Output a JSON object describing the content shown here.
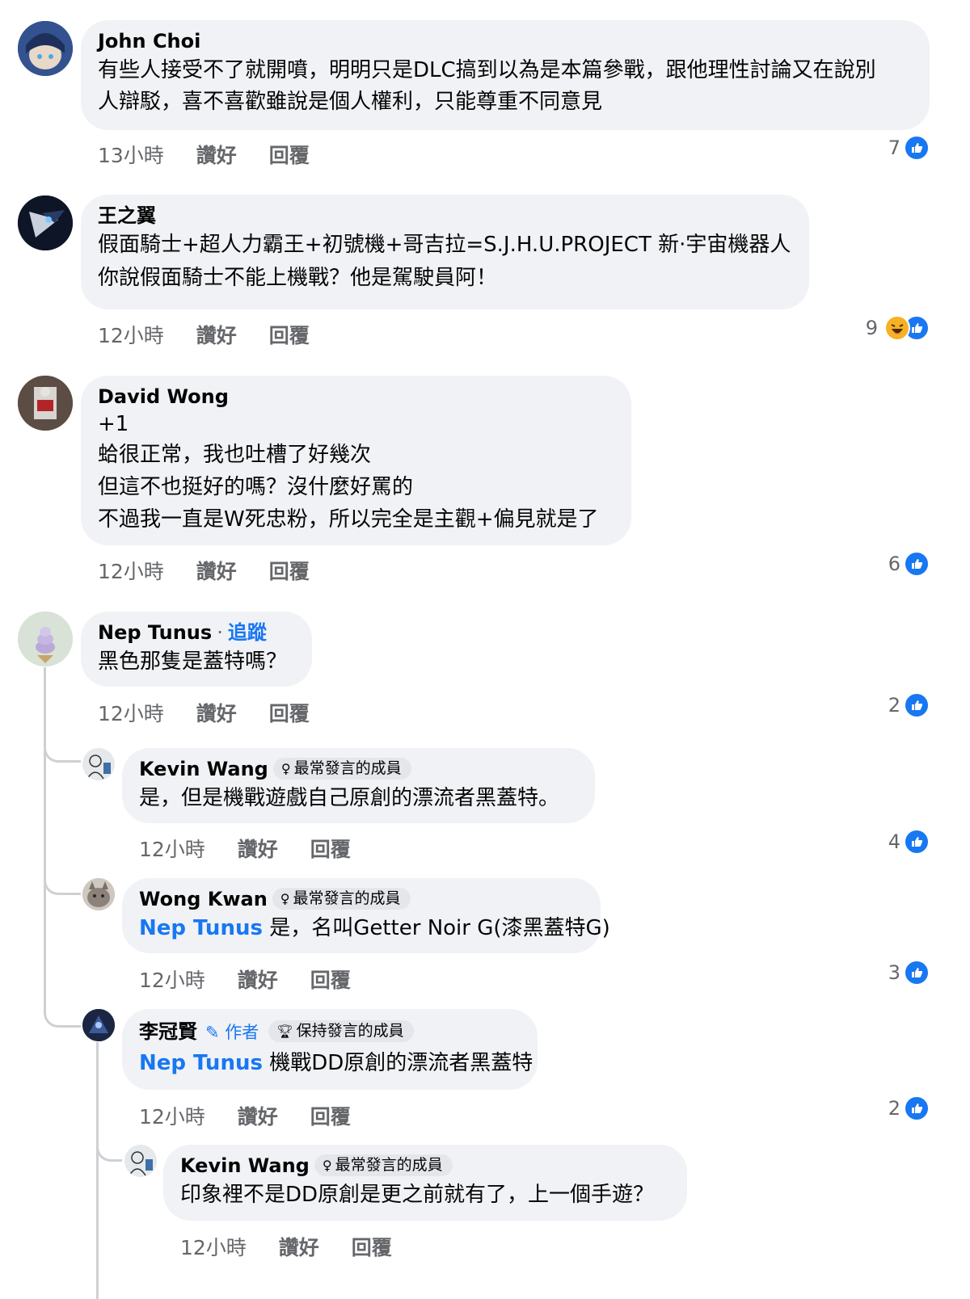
{
  "comments": [
    {
      "author": "John Choi",
      "lines": [
        "有些人接受不了就開噴，明明只是DLC搞到以為是本篇參戰，跟他理性討論又在說別",
        "人辯駁，喜不喜歡雖說是個人權利，只能尊重不同意見"
      ],
      "time": "13小時",
      "like": "讚好",
      "reply": "回覆",
      "reactions": "7"
    },
    {
      "author": "王之翼",
      "lines": [
        "假面騎士+超人力霸王+初號機+哥吉拉=S.J.H.U.PROJECT 新·宇宙機器人",
        "你說假面騎士不能上機戰？他是駕駛員阿！"
      ],
      "time": "12小時",
      "like": "讚好",
      "reply": "回覆",
      "reactions": "9"
    },
    {
      "author": "David Wong",
      "lines": [
        "+1",
        "蛤很正常，我也吐槽了好幾次",
        "但這不也挺好的嗎？沒什麼好罵的",
        "不過我一直是W死忠粉，所以完全是主觀+偏見就是了"
      ],
      "time": "12小時",
      "like": "讚好",
      "reply": "回覆",
      "reactions": "6"
    },
    {
      "author": "Nep Tunus",
      "follow": "追蹤",
      "lines": [
        "黑色那隻是蓋特嗎？"
      ],
      "time": "12小時",
      "like": "讚好",
      "reply": "回覆",
      "reactions": "2"
    },
    {
      "author": "Kevin Wang",
      "badge": "最常發言的成員",
      "lines": [
        "是，但是機戰遊戲自己原創的漂流者黑蓋特。"
      ],
      "time": "12小時",
      "like": "讚好",
      "reply": "回覆",
      "reactions": "4"
    },
    {
      "author": "Wong Kwan",
      "badge": "最常發言的成員",
      "mention": "Nep Tunus",
      "lines": [
        " 是，名叫Getter Noir G(漆黑蓋特G)"
      ],
      "time": "12小時",
      "like": "讚好",
      "reply": "回覆",
      "reactions": "3"
    },
    {
      "author": "李冠賢",
      "author_tag": "作者",
      "badge": "保持發言的成員",
      "mention": "Nep Tunus",
      "lines": [
        " 機戰DD原創的漂流者黑蓋特"
      ],
      "time": "12小時",
      "like": "讚好",
      "reply": "回覆",
      "reactions": "2"
    },
    {
      "author": "Kevin Wang",
      "badge": "最常發言的成員",
      "lines": [
        "印象裡不是DD原創是更之前就有了，上一個手遊？"
      ],
      "time": "12小時",
      "like": "讚好",
      "reply": "回覆"
    }
  ],
  "colors": {
    "link": "#1877f2",
    "bubble": "#f0f2f5",
    "meta": "#65676b"
  },
  "icons": {
    "like": "thumbs-up-icon",
    "haha": "haha-icon",
    "badge": "contributor-icon",
    "author": "pencil-icon",
    "trophy": "trophy-icon"
  }
}
